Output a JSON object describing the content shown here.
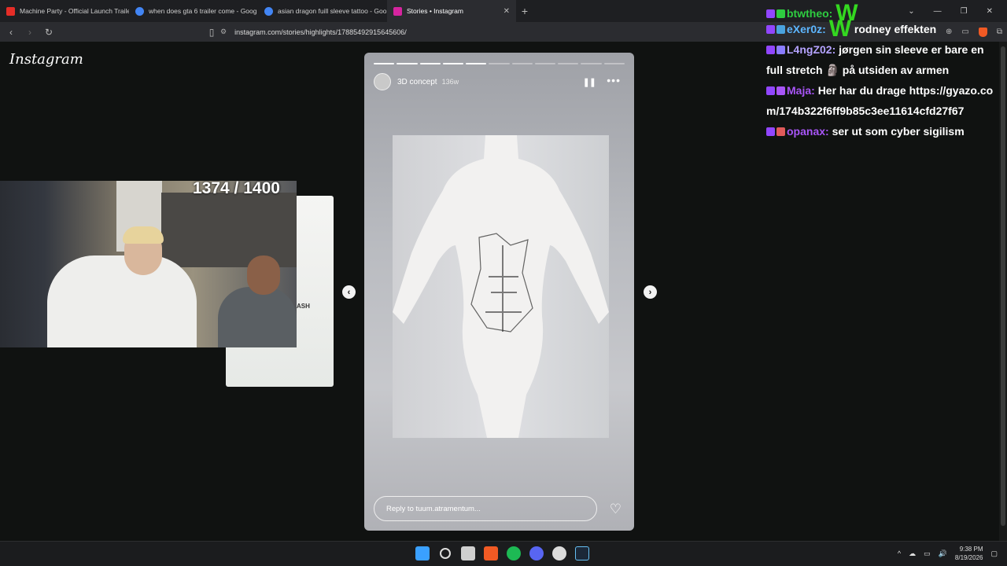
{
  "tabs": [
    {
      "title": "Machine Party - Official Launch Traile",
      "favicon_color": "#e52d27"
    },
    {
      "title": "when does gta 6 trailer come - Goog",
      "favicon_color": "#4285f4"
    },
    {
      "title": "asian dragon fuill sleeve tattoo - Goo",
      "favicon_color": "#4285f4"
    },
    {
      "title": "Stories • Instagram",
      "favicon_color": "#d6249f"
    }
  ],
  "new_tab": "+",
  "url": "instagram.com/stories/highlights/17885492915645606/",
  "instagram_logo": "Instagram",
  "story": {
    "username": "3D concept",
    "age": "136w",
    "segments_total": 11,
    "segments_done": 5,
    "reply_placeholder": "Reply to tuum.atramentum..."
  },
  "prev_story_text": "ASH",
  "stream_counter": "1374 / 1400",
  "chat": [
    {
      "user": "btwtheo:",
      "user_color": "#2ecc40",
      "message": "W",
      "big": true
    },
    {
      "user": "eXer0z:",
      "user_color": "#5db6ff",
      "message": "W rodney effekten",
      "big_prefix": "W",
      "rest": "rodney effekten"
    },
    {
      "user": "L4ngZ02:",
      "user_color": "#b5a3ff",
      "message": "jørgen sin sleeve er bare en full stretch 🗿 på utsiden av armen"
    },
    {
      "user": "Maja:",
      "user_color": "#a855f7",
      "message": "Her har du drage https://gyazo.com/174b322f6ff9b85c3ee11614cfd27f67"
    },
    {
      "user": "opanax:",
      "user_color": "#a855f7",
      "message": "ser ut som cyber sigilism"
    }
  ],
  "clock": {
    "time": "9:38 PM",
    "date": "8/19/2026"
  }
}
